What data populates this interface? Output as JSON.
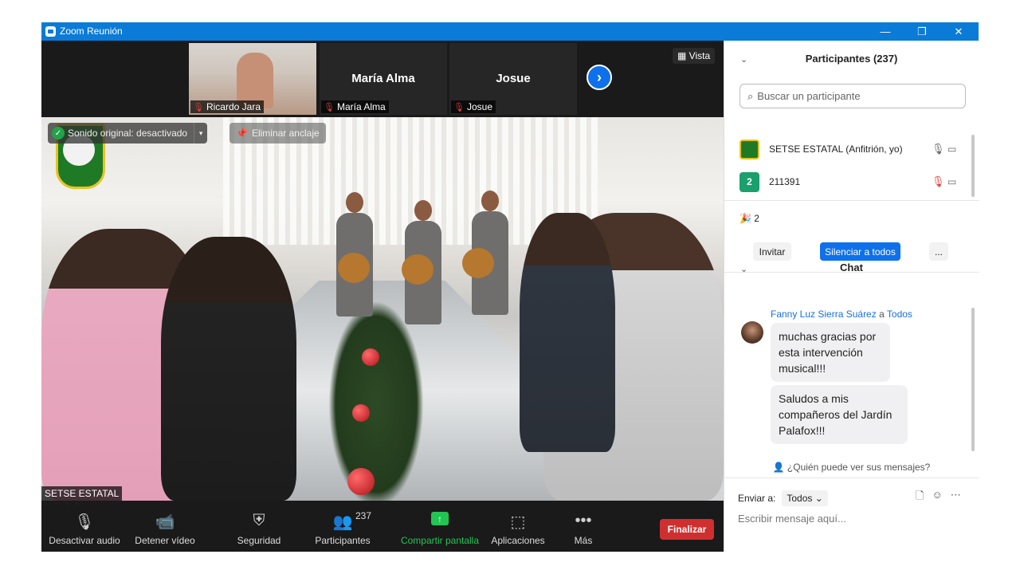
{
  "window": {
    "title": "Zoom Reunión",
    "minimize_glyph": "—",
    "restore_glyph": "❐",
    "close_glyph": "✕"
  },
  "strip": {
    "thumbnails": [
      {
        "name": "Ricardo Jara",
        "label": "Ricardo Jara",
        "muted": true
      },
      {
        "name": "María Alma",
        "label": "María Alma",
        "muted": true
      },
      {
        "name": "Josue",
        "label": "Josue",
        "muted": true
      }
    ],
    "next_glyph": "›",
    "view_label": "Vista"
  },
  "video": {
    "sound_label": "Sonido original: desactivado",
    "unpin_label": "Eliminar anclaje",
    "speaker_name": "SETSE ESTATAL"
  },
  "toolbar": {
    "mute_label": "Desactivar audio",
    "video_label": "Detener vídeo",
    "security_label": "Seguridad",
    "participants_label": "Participantes",
    "participants_count": "237",
    "share_label": "Compartir pantalla",
    "apps_label": "Aplicaciones",
    "more_label": "Más",
    "end_label": "Finalizar",
    "colors": {
      "share": "#23c552",
      "end": "#d02f2f"
    }
  },
  "participants_panel": {
    "title": "Participantes (237)",
    "search_placeholder": "Buscar un participante",
    "participants": [
      {
        "name": "SETSE ESTATAL (Anfitrión, yo)",
        "avatar": "",
        "muted": false
      },
      {
        "name": "211391",
        "avatar": "2",
        "muted": true
      }
    ],
    "raised_hands_count": "2",
    "invite_label": "Invitar",
    "mute_all_label": "Silenciar a todos",
    "more_label": "..."
  },
  "chat_panel": {
    "title": "Chat",
    "sender": "Fanny Luz Sierra Suárez",
    "sender_connector": "a",
    "recipient": "Todos",
    "messages": [
      "muchas gracias por esta intervención musical!!!",
      "Saludos a mis compañeros del Jardín Palafox!!!"
    ],
    "who_can_see": "¿Quién puede ver sus mensajes?",
    "send_to_label": "Enviar a:",
    "send_to_value": "Todos",
    "input_placeholder": "Escribir mensaje aquí..."
  },
  "colors": {
    "titlebar": "#0b7bd8",
    "accent": "#0e71eb",
    "meeting_bg": "#1a1a1a",
    "avatar_green": "#1aa06d"
  }
}
